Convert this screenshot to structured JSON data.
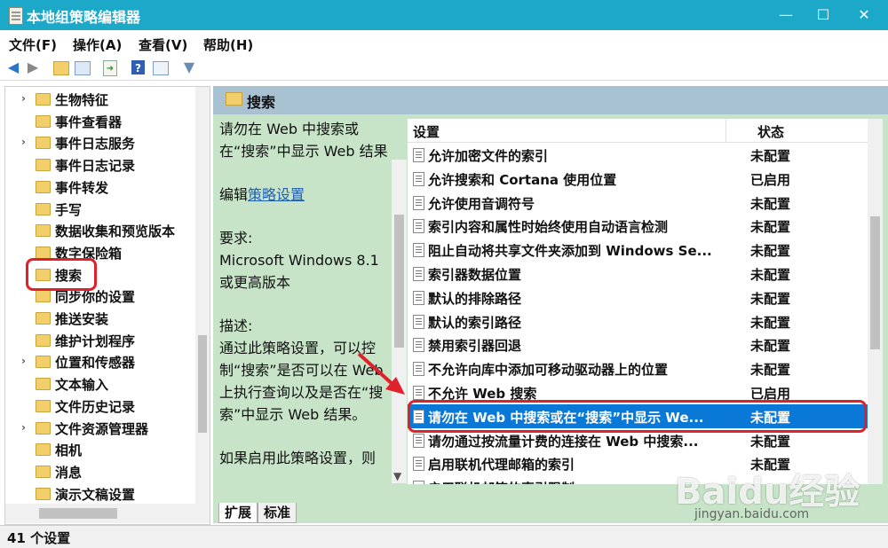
{
  "window": {
    "title": "本地组策略编辑器",
    "minimize": "—",
    "maximize": "☐",
    "close": "✕"
  },
  "menu": [
    "文件(F)",
    "操作(A)",
    "查看(V)",
    "帮助(H)"
  ],
  "toolbar": {
    "back": "back-icon",
    "forward": "forward-icon",
    "up": "up-folder-icon",
    "show_hide": "console-tree-icon",
    "export": "export-list-icon",
    "help": "help-icon",
    "properties": "properties-icon",
    "filter": "filter-icon"
  },
  "tree": {
    "items": [
      {
        "label": "生物特征",
        "expandable": true
      },
      {
        "label": "事件查看器",
        "expandable": false
      },
      {
        "label": "事件日志服务",
        "expandable": true
      },
      {
        "label": "事件日志记录",
        "expandable": false
      },
      {
        "label": "事件转发",
        "expandable": false
      },
      {
        "label": "手写",
        "expandable": false
      },
      {
        "label": "数据收集和预览版本",
        "expandable": false
      },
      {
        "label": "数字保险箱",
        "expandable": false
      },
      {
        "label": "搜索",
        "expandable": false,
        "selected": true
      },
      {
        "label": "同步你的设置",
        "expandable": false
      },
      {
        "label": "推送安装",
        "expandable": false
      },
      {
        "label": "维护计划程序",
        "expandable": false
      },
      {
        "label": "位置和传感器",
        "expandable": true
      },
      {
        "label": "文本输入",
        "expandable": false
      },
      {
        "label": "文件历史记录",
        "expandable": false
      },
      {
        "label": "文件资源管理器",
        "expandable": true
      },
      {
        "label": "相机",
        "expandable": false
      },
      {
        "label": "消息",
        "expandable": false
      },
      {
        "label": "演示文稿设置",
        "expandable": false
      }
    ]
  },
  "header": {
    "title": "搜索"
  },
  "description": {
    "title": "请勿在 Web 中搜索或在“搜索”中显示 Web 结果",
    "edit_prefix": "编辑",
    "edit_link": "策略设置",
    "requirements_label": "要求:",
    "requirements_text": "Microsoft Windows 8.1 或更高版本",
    "desc_label": "描述:",
    "desc_text": "通过此策略设置，可以控制“搜索”是否可以在 Web 上执行查询以及是否在“搜索”中显示 Web 结果。",
    "more_text": "如果启用此策略设置，则"
  },
  "list": {
    "col_setting": "设置",
    "col_state": "状态",
    "rows": [
      {
        "name": "允许加密文件的索引",
        "state": "未配置"
      },
      {
        "name": "允许搜索和 Cortana 使用位置",
        "state": "已启用"
      },
      {
        "name": "允许使用音调符号",
        "state": "未配置"
      },
      {
        "name": "索引内容和属性时始终使用自动语言检测",
        "state": "未配置"
      },
      {
        "name": "阻止自动将共享文件夹添加到 Windows Se...",
        "state": "未配置"
      },
      {
        "name": "索引器数据位置",
        "state": "未配置"
      },
      {
        "name": "默认的排除路径",
        "state": "未配置"
      },
      {
        "name": "默认的索引路径",
        "state": "未配置"
      },
      {
        "name": "禁用索引器回退",
        "state": "未配置"
      },
      {
        "name": "不允许向库中添加可移动驱动器上的位置",
        "state": "未配置"
      },
      {
        "name": "不允许 Web 搜索",
        "state": "已启用"
      },
      {
        "name": "请勿在 Web 中搜索或在“搜索”中显示 We...",
        "state": "未配置",
        "selected": true
      },
      {
        "name": "请勿通过按流量计费的连接在 Web 中搜索...",
        "state": "未配置"
      },
      {
        "name": "启用联机代理邮箱的索引",
        "state": "未配置"
      },
      {
        "name": "启用联机邮箱的索引限制",
        "state": ""
      }
    ]
  },
  "tabs": [
    "扩展",
    "标准"
  ],
  "status": {
    "text": "41 个设置"
  },
  "watermark": {
    "brand": "Baidu经验",
    "url": "jingyan.baidu.com"
  },
  "colors": {
    "titlebar": "#1ba8c9",
    "selection": "#0a78d7",
    "pane": "#c7e4c8",
    "annotation": "#e0202a"
  }
}
